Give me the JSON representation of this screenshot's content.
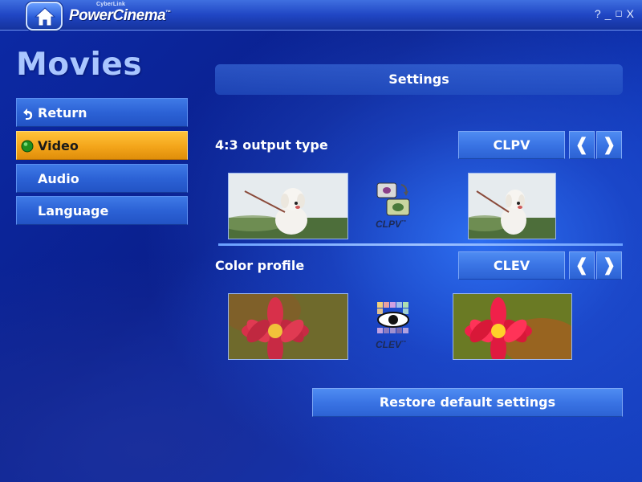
{
  "app": {
    "brand_small": "CyberLink",
    "brand": "PowerCinema",
    "trademark": "™",
    "window_controls": [
      "?",
      "_",
      "◻",
      "X"
    ]
  },
  "page": {
    "title": "Movies"
  },
  "menu": {
    "items": [
      {
        "label": "Return",
        "icon": "return-arrow-icon"
      },
      {
        "label": "Video",
        "icon": "green-dot-icon",
        "active": true
      },
      {
        "label": "Audio"
      },
      {
        "label": "Language"
      }
    ]
  },
  "settings": {
    "header": "Settings",
    "output_type": {
      "label": "4:3 output type",
      "value": "CLPV",
      "badge": "CLPV",
      "badge_tm": "™"
    },
    "color_profile": {
      "label": "Color profile",
      "value": "CLEV",
      "badge": "CLEV",
      "badge_tm": "™"
    },
    "restore_label": "Restore default settings",
    "prev_arrow": "❰",
    "next_arrow": "❱"
  },
  "colors": {
    "accent_active": "#f3a51a",
    "button_blue": "#3a74e4",
    "title_light_blue": "#a9c6ff"
  }
}
